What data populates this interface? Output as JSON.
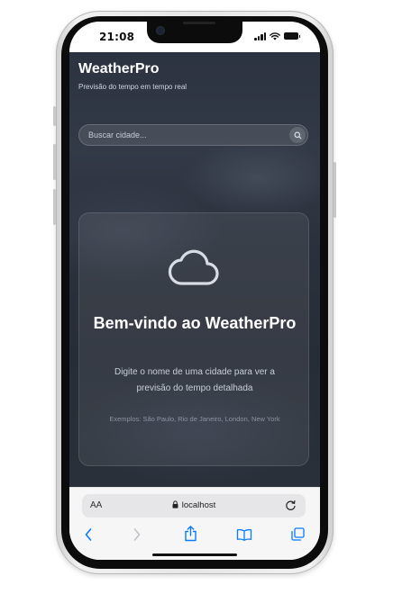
{
  "status_bar": {
    "time": "21:08"
  },
  "app": {
    "title": "WeatherPro",
    "subtitle": "Previsão do tempo em tempo real",
    "search": {
      "placeholder": "Buscar cidade...",
      "value": ""
    },
    "welcome": {
      "title": "Bem-vindo ao WeatherPro",
      "description": "Digite o nome de uma cidade para ver a previsão do tempo detalhada",
      "examples": "Exemplos: São Paulo, Rio de Janeiro, London, New York"
    }
  },
  "browser": {
    "text_size_label": "AA",
    "url": "localhost"
  },
  "colors": {
    "app_background": "#2c3340",
    "card_background": "rgba(255,255,255,0.07)",
    "browser_accent": "#0a7aff"
  },
  "icons": {
    "search": "search-icon",
    "cloud": "cloud-icon",
    "lock": "lock-icon",
    "reload": "reload-icon",
    "back": "chevron-left-icon",
    "forward": "chevron-right-icon",
    "share": "share-icon",
    "bookmarks": "book-icon",
    "tabs": "tabs-icon"
  }
}
